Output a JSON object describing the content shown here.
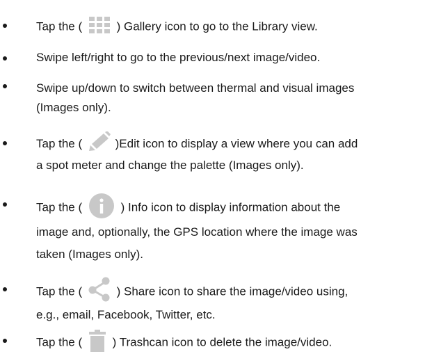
{
  "items": [
    {
      "prefix": "Tap the (",
      "icon": "grid-icon",
      "suffix": ") Gallery icon to go to the Library view."
    },
    {
      "text": "Swipe left/right to go to the previous/next image/video."
    },
    {
      "line1": "Swipe up/down to switch between thermal and visual images",
      "line2": "(Images only)."
    },
    {
      "prefix": "Tap the (",
      "icon": "pencil-icon",
      "suffix": ")Edit icon to display a view where you can add",
      "line2": "a spot meter and change the palette (Images only)."
    },
    {
      "prefix": "Tap the (",
      "icon": "info-icon",
      "suffix": ") Info icon to display information about the",
      "line2": "image and, optionally, the GPS location where the image was",
      "line3": "taken (Images only)."
    },
    {
      "prefix": "Tap the (",
      "icon": "share-icon",
      "suffix": ") Share icon to share the image/video using,",
      "line2": "e.g., email, Facebook, Twitter, etc."
    },
    {
      "prefix": "Tap the (",
      "icon": "trashcan-icon",
      "suffix": ") Trashcan icon to delete the image/video."
    }
  ],
  "colors": {
    "text": "#1a1a1a",
    "icon": "#c8c8c8"
  }
}
